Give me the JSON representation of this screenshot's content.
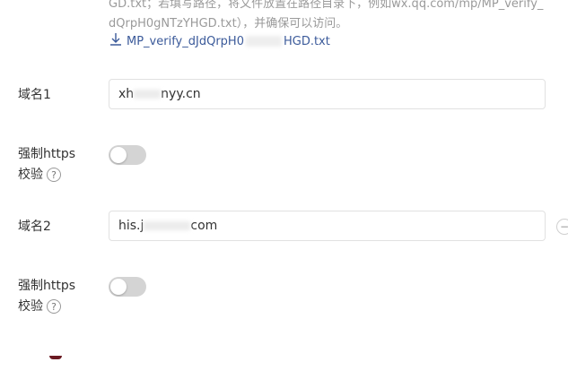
{
  "help": {
    "line1": "GD.txt；若填写路径，将文件放置在路径目录下，例如wx.qq.com/mp/MP_verify_",
    "line2": "dQrpH0gNTzYHGD.txt），并确保可以访问。"
  },
  "download": {
    "icon": "download-icon",
    "label": "MP_verify_dJdQrpH0",
    "label_tail": "HGD.txt"
  },
  "domain1": {
    "label": "域名1",
    "value_start": "xh",
    "value_end": "nyy.cn"
  },
  "https1": {
    "label_line1": "强制https",
    "label_line2": "校验",
    "help_icon": "?",
    "enabled": false
  },
  "domain2": {
    "label": "域名2",
    "value_start": "his.j",
    "value_end": "com"
  },
  "https2": {
    "label_line1": "强制https",
    "label_line2": "校验",
    "help_icon": "?",
    "enabled": false
  },
  "side_button": {
    "icon": "minus-icon",
    "glyph": "−"
  }
}
